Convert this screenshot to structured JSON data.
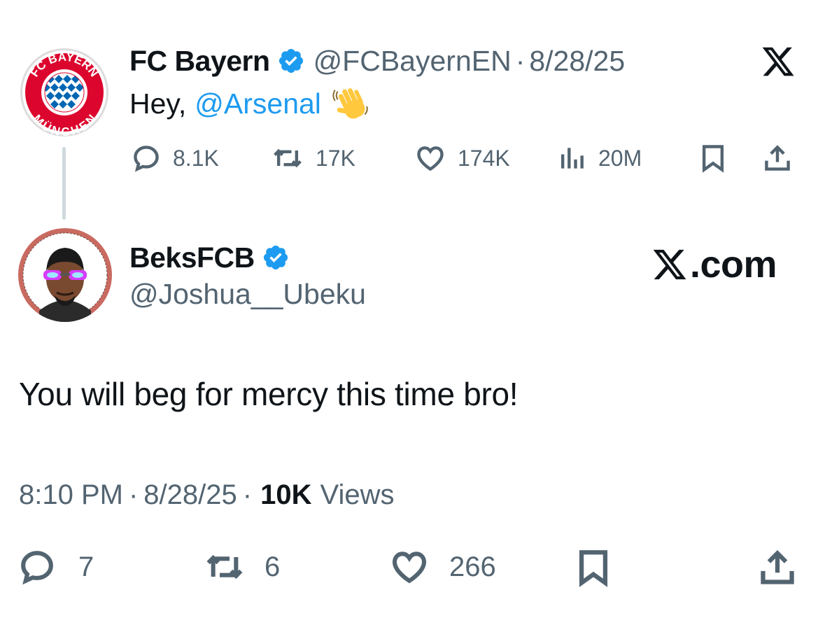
{
  "quoted_tweet": {
    "author_name": "FC Bayern",
    "author_handle": "@FCBayernEN",
    "separator": "·",
    "date": "8/28/25",
    "text_prefix": "Hey,",
    "mention": "@Arsenal",
    "emoji": "waving-hand",
    "avatar_text_top": "FC BAYERN",
    "avatar_text_bottom": "MÜNCHEN",
    "stats": {
      "replies": "8.1K",
      "reposts": "17K",
      "likes": "174K",
      "views": "20M"
    }
  },
  "main_tweet": {
    "author_name": "BeksFCB",
    "author_handle": "@Joshua__Ubeku",
    "site_label": ".com",
    "body": "You will beg for mercy this time bro!",
    "time": "8:10 PM",
    "separator": "·",
    "date": "8/28/25",
    "views_count": "10K",
    "views_label": "Views",
    "stats": {
      "replies": "7",
      "reposts": "6",
      "likes": "266"
    }
  },
  "colors": {
    "accent_blue": "#1d9bf0",
    "secondary_text": "#536471",
    "bayern_red": "#dc052d",
    "bayern_blue": "#0066b2",
    "thread_line": "#cfd9de"
  }
}
